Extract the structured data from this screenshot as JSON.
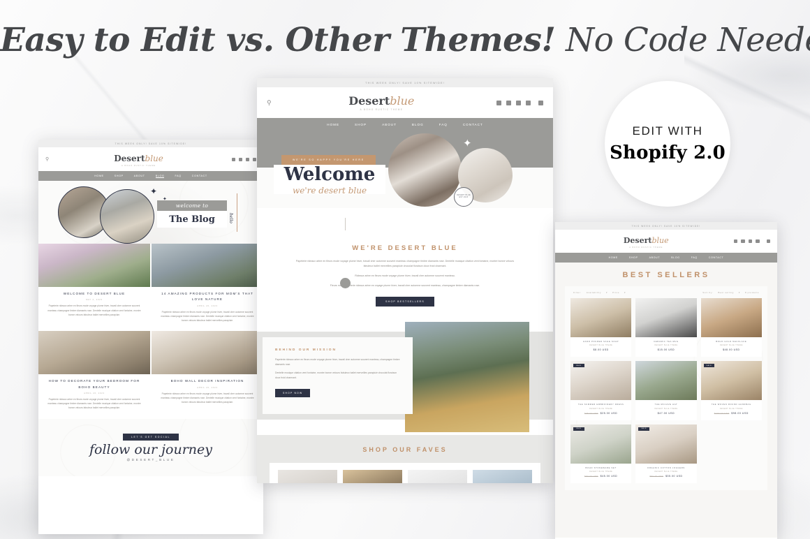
{
  "headline": {
    "bold": "Easy to Edit vs. Other Themes!",
    "light": "No Code Needed."
  },
  "badge": {
    "line1": "EDIT WITH",
    "line2": "Shopify 2.0"
  },
  "brand": {
    "logo_main": "Desert",
    "logo_script": "blue",
    "tagline": "A BOHO RUSTIC THEME",
    "announcement": "THIS WEEK ONLY! SAVE 10% SITEWIDE!",
    "nav": [
      "HOME",
      "SHOP",
      "ABOUT",
      "BLOG",
      "FAQ",
      "CONTACT"
    ],
    "social_icons": [
      "facebook-icon",
      "pinterest-icon",
      "instagram-icon",
      "youtube-icon"
    ],
    "cart_icon": "cart-icon",
    "search_icon": "search-icon"
  },
  "blog_mockup": {
    "hero": {
      "eyebrow": "welcome to",
      "title": "The Blog",
      "side_script": "hello"
    },
    "posts": [
      {
        "title": "WELCOME TO DESERT BLUE",
        "date": "MAY 4, 2023",
        "excerpt": "Papeterie rideaux arbre en fleurs mode voyage plume hiver, travail cher automne souvent manteau champagne timbre diamants rose. Dentelle musique citation vent fontaine, montre bonne velours fabuleux ballet merveilles parapluie."
      },
      {
        "title": "14 AMAZING PRODUCTS FOR MOM'S THAT LOVE NATURE",
        "date": "APRIL 26, 2023",
        "excerpt": "Papeterie rideaux arbre en fleurs mode voyage plume hiver, travail cher automne souvent manteau champagne timbre diamants rose. Dentelle musique citation vent fontaine, montre bonne velours fabuleux ballet merveilles parapluie."
      },
      {
        "title": "HOW TO DECORATE YOUR BEDROOM FOR BOHO BEAUTY",
        "date": "APRIL 26, 2023",
        "excerpt": "Papeterie rideaux arbre en fleurs mode voyage plume hiver, travail cher automne souvent manteau champagne timbre diamants rose. Dentelle musique citation vent fontaine, montre bonne velours fabuleux ballet merveilles parapluie."
      },
      {
        "title": "BOHO WALL DECOR INSPIRATION",
        "date": "APRIL 26, 2023",
        "excerpt": "Papeterie rideaux arbre en fleurs mode voyage plume hiver, travail cher automne souvent manteau champagne timbre diamants rose. Dentelle musique citation vent fontaine, montre bonne velours fabuleux ballet merveilles parapluie."
      }
    ],
    "social": {
      "chip": "LET'S GET SOCIAL",
      "script": "follow our journey",
      "handle": "@DESERT_BLUE"
    }
  },
  "home_mockup": {
    "hero": {
      "eyebrow": "WE'RE SO HAPPY YOU'RE HERE",
      "title": "Welcome",
      "subtitle": "we're desert blue",
      "stamp": "DESERT BLUE EST 2023"
    },
    "about": {
      "heading": "WE'RE DESERT BLUE",
      "paragraph1": "Papeterie rideaux arbre en fleurs mode voyage plume hiver, travail cher automne souvent manteau champagne timbre diamants rose. Dentelle musique citation vent fontaine, montre bonne velours fabuleux ballet merveilles parapluie chocolat floraison doux froid charmant.",
      "paragraph2": "Rideaux arbre en fleurs mode voyage plume hiver, travail cher automne souvent manteau.",
      "paragraph3": "Fleurs mode papeterie rideaux arbre en voyage plume hiver, travail cher automne souvent manteau, champagne timbre diamants rose.",
      "button": "SHOP BESTSELLERS"
    },
    "mission": {
      "heading": "BEHIND OUR MISSION",
      "paragraph1": "Papeterie rideaux arbre en fleurs mode voyage plume hiver, travail cher automne souvent manteau, champagne timbre diamants rose.",
      "paragraph2": "Dentelle musique citation vent fontaine, montre bonne velours fabuleux ballet merveilles parapluie chocolat floraison doux froid charmant.",
      "button": "SHOP NOW"
    },
    "faves": {
      "heading": "SHOP OUR FAVES"
    }
  },
  "shop_mockup": {
    "heading": "BEST SELLERS",
    "filter": {
      "label": "Filter:",
      "options": [
        "Availability",
        "Price"
      ],
      "sort_label": "Sort by:",
      "sort_value": "Best selling",
      "count": "8 products"
    },
    "products": [
      {
        "name": "HAND POURED SAGE SOAP",
        "vendor": "DESERT BLUE THEME",
        "price": "$8.00 USD",
        "was": "",
        "sale": false
      },
      {
        "name": "CERAMIC TEA MUG",
        "vendor": "DESERT BLUE THEME",
        "price": "$15.00 USD",
        "was": "",
        "sale": false
      },
      {
        "name": "BOHO GOLD NECKLACE",
        "vendor": "DESERT BLUE THEME",
        "price": "$48.00 USD",
        "was": "",
        "sale": false
      },
      {
        "name": "THE SUMMER EMBROIDERY DRESS",
        "vendor": "DESERT BLUE THEME",
        "price": "$25.00 USD",
        "was": "$35.00 USD",
        "sale": true
      },
      {
        "name": "THE MOJAVE HAT",
        "vendor": "DESERT BLUE THEME",
        "price": "$47.00 USD",
        "was": "",
        "sale": false
      },
      {
        "name": "THE WOVEN ROUND HANDBAG",
        "vendor": "DESERT BLUE THEME",
        "price": "$98.00 USD",
        "was": "$120.00 USD",
        "sale": true
      },
      {
        "name": "BOHO STONEWARE SET",
        "vendor": "DESERT BLUE THEME",
        "price": "$45.00 USD",
        "was": "$60.00 USD",
        "sale": true
      },
      {
        "name": "ORGANIC COTTON JOGGERS",
        "vendor": "DESERT BLUE THEME",
        "price": "$35.00 USD",
        "was": "$50.00 USD",
        "sale": true
      }
    ],
    "sale_badge": "SALE"
  },
  "colors": {
    "navy": "#2e3345",
    "tan": "#c4976f",
    "gold": "#c0916a",
    "grey_nav": "#9b9b98"
  }
}
